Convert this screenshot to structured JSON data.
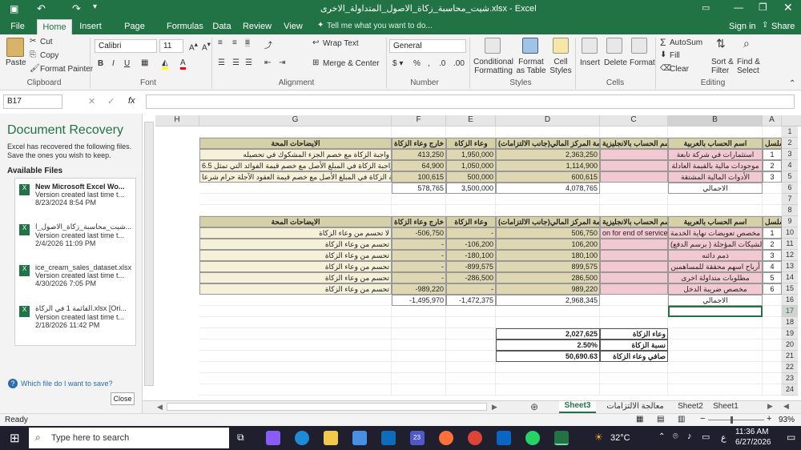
{
  "title": {
    "text": "شيت_محاسبة_زكاة_الاصول_المتداولة_الاخرى.xlsx - Excel",
    "signin": "Sign in",
    "share": "Share"
  },
  "tabs": [
    "File",
    "Home",
    "Insert",
    "Page Layout",
    "Formulas",
    "Data",
    "Review",
    "View"
  ],
  "tell_me": "Tell me what you want to do...",
  "ribbon": {
    "paste": "Paste",
    "cut": "Cut",
    "copy": "Copy",
    "format_painter": "Format Painter",
    "clipboard": "Clipboard",
    "font_name": "Calibri",
    "font_size": "11",
    "font": "Font",
    "wrap_text": "Wrap Text",
    "merge_center": "Merge & Center",
    "alignment": "Alignment",
    "number_format": "General",
    "number": "Number",
    "conditional": "Conditional Formatting",
    "format_table": "Format as Table",
    "cell_styles": "Cell Styles",
    "styles": "Styles",
    "insert": "Insert",
    "delete": "Delete",
    "format": "Format",
    "cells": "Cells",
    "autosum": "AutoSum",
    "fill": "Fill",
    "clear": "Clear",
    "sort_filter": "Sort & Filter",
    "find_select": "Find & Select",
    "editing": "Editing"
  },
  "formula_bar": {
    "name_box": "B17",
    "fx": "fx",
    "value": ""
  },
  "recovery": {
    "title": "Document Recovery",
    "desc": "Excel has recovered the following files. Save the ones you wish to keep.",
    "available": "Available Files",
    "files": [
      {
        "name": "New Microsoft Excel Wo...",
        "ver": "Version created last time t...",
        "date": "8/23/2024 8:54 PM"
      },
      {
        "name": "شيت_محاسبة_زكاة_الاصول_ا...",
        "ver": "Version created last time t...",
        "date": "2/4/2026 11:09 PM"
      },
      {
        "name": "ice_cream_sales_dataset.xlsx",
        "ver": "Version created last time t...",
        "date": "4/30/2026 7:05 PM"
      },
      {
        "name": "القائمة 1 في الزكاة.xlsx [Ori...",
        "ver": "Version created last time t...",
        "date": "2/18/2026 11:42 PM"
      }
    ],
    "which": "Which file do I want to save?",
    "close": "Close"
  },
  "columns": [
    "H",
    "G",
    "F",
    "E",
    "D",
    "C",
    "B",
    "A"
  ],
  "rows": [
    "1",
    "2",
    "3",
    "4",
    "5",
    "6",
    "7",
    "8",
    "9",
    "10",
    "11",
    "12",
    "13",
    "14",
    "15",
    "16",
    "17",
    "18",
    "19",
    "20",
    "21",
    "22",
    "23",
    "24"
  ],
  "table1": {
    "headers": {
      "a": "التسلسل",
      "b": "اسم الحساب بالعربية",
      "c": "اسم الحساب بالانجليزية",
      "d": "قائمة المركز المالي(جانب الالتزامات)",
      "e": "وعاء الزكاة",
      "f": "خارج وعاء الزكاة",
      "g": "الايضاحات المحة"
    },
    "rows": [
      {
        "a": "1",
        "b": "استثمارات في شركة تابعة",
        "d": "2,363,250",
        "e": "1,950,000",
        "f": "413,250",
        "g": "واجبة الزكاة مع خصم الجزء المشكوك في تحصيله"
      },
      {
        "a": "2",
        "b": "موجودات مالية بالقيمة العادلة",
        "d": "1,114,900",
        "e": "1,050,000",
        "f": "64,900",
        "g": "واجبة الزكاة في المبلغ الأصل مع خصم قيمة الفوائد التي تمثل 6.5%"
      },
      {
        "a": "3",
        "b": "الأدوات المالية المشتقة",
        "d": "600,615",
        "e": "500,000",
        "f": "100,615",
        "g": "واجبة الزكاة في المبلغ الأصل مع خصم قيمة العقود الآجلة حرام شرعا"
      }
    ],
    "total_label": "الاجمالي",
    "total_d": "4,078,765",
    "total_e": "3,500,000",
    "total_f": "578,765"
  },
  "table2": {
    "headers": {
      "a": "التسلسل",
      "b": "اسم الحساب بالعربية",
      "c": "اسم الحساب بالانجليزية",
      "d": "قائمة المركز المالي(جانب الالتزامات)",
      "e": "وعاء الزكاة",
      "f": "خارج وعاء الزكاة",
      "g": "الايضاحات المحة"
    },
    "rows": [
      {
        "a": "1",
        "b": "مخصص تعويضات نهاية الخدمة",
        "c": "on for end of services",
        "d": "506,750",
        "e": "-",
        "f": "-506,750",
        "g": "لا تحسم من وعاء الزكاة"
      },
      {
        "a": "2",
        "b": "الشيكات المؤجلة ( برسم الدفع)",
        "c": "",
        "d": "106,200",
        "e": "-106,200",
        "f": "-",
        "g": "تحسم من وعاء الزكاة"
      },
      {
        "a": "3",
        "b": "ذمم دائنه",
        "c": "",
        "d": "180,100",
        "e": "-180,100",
        "f": "-",
        "g": "تحسم من وعاء الزكاة"
      },
      {
        "a": "4",
        "b": "أرباح اسهم محققة للمساهمين",
        "c": "",
        "d": "899,575",
        "e": "-899,575",
        "f": "-",
        "g": "تحسم من وعاء الزكاة"
      },
      {
        "a": "5",
        "b": "مطلوبات متداولة اخرى",
        "c": "",
        "d": "286,500",
        "e": "-286,500",
        "f": "-",
        "g": "تحسم من وعاء الزكاة"
      },
      {
        "a": "6",
        "b": "مخصص ضريبة الدخل",
        "c": "",
        "d": "989,220",
        "e": "-",
        "f": "-989,220",
        "g": "تحسم من وعاء الزكاة"
      }
    ],
    "total_label": "الاجمالي",
    "total_d": "2,968,345",
    "total_e": "-1,472,375",
    "total_f": "-1,495,970"
  },
  "summary": [
    {
      "label": "وعاء الزكاة",
      "value": "2,027,625"
    },
    {
      "label": "نسبة الزكاة",
      "value": "2.50%"
    },
    {
      "label": "صافي وعاء الزكاة",
      "value": "50,690.63"
    }
  ],
  "sheets": [
    "Sheet3",
    "معالجة الالتزامات",
    "Sheet2",
    "Sheet1"
  ],
  "status": {
    "ready": "Ready",
    "zoom": "93%"
  },
  "taskbar": {
    "search": "Type here to search",
    "temp": "32°C",
    "time": "11:36 AM",
    "date": "6/27/2026",
    "lang": "ع",
    "badge": "23"
  },
  "colors": {
    "excel_green": "#217346",
    "header_fill": "#d6d0a8",
    "pink": "#f2c9d3",
    "tan": "#ded7b2",
    "light": "#f5f0d8"
  }
}
